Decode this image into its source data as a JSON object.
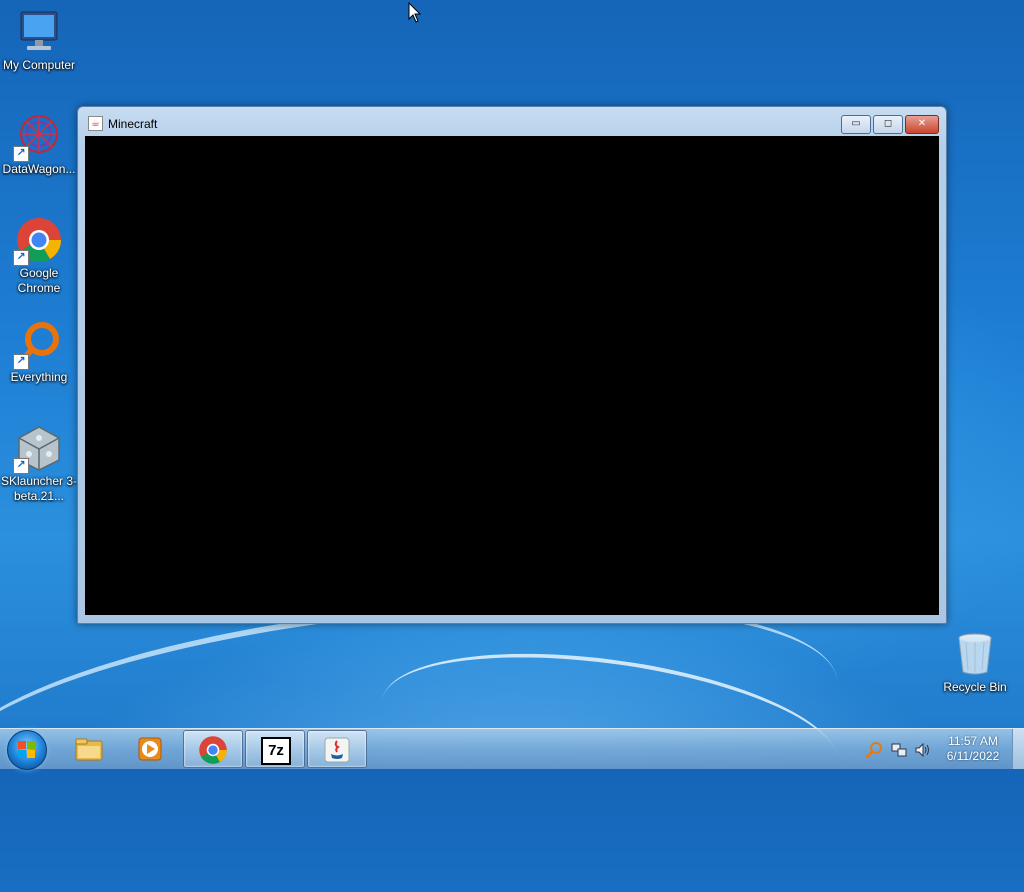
{
  "desktop": {
    "icons": [
      {
        "label": "My Computer"
      },
      {
        "label": "DataWagon..."
      },
      {
        "label": "Google Chrome"
      },
      {
        "label": "Everything"
      },
      {
        "label": "SKlauncher 3-beta.21..."
      },
      {
        "label": "Recycle Bin"
      }
    ]
  },
  "window": {
    "title": "Minecraft",
    "buttons": {
      "minimize": "▭",
      "maximize": "◻",
      "close": "✕"
    }
  },
  "taskbar": {
    "items": [
      {
        "name": "Windows Explorer"
      },
      {
        "name": "Windows Media Player"
      },
      {
        "name": "Google Chrome"
      },
      {
        "name": "7-Zip",
        "label": "7z"
      },
      {
        "name": "Java"
      }
    ],
    "clock": {
      "time": "11:57 AM",
      "date": "6/11/2022"
    }
  },
  "colors": {
    "window_client": "#000000",
    "taskbar_active": "#d6e8f8"
  }
}
